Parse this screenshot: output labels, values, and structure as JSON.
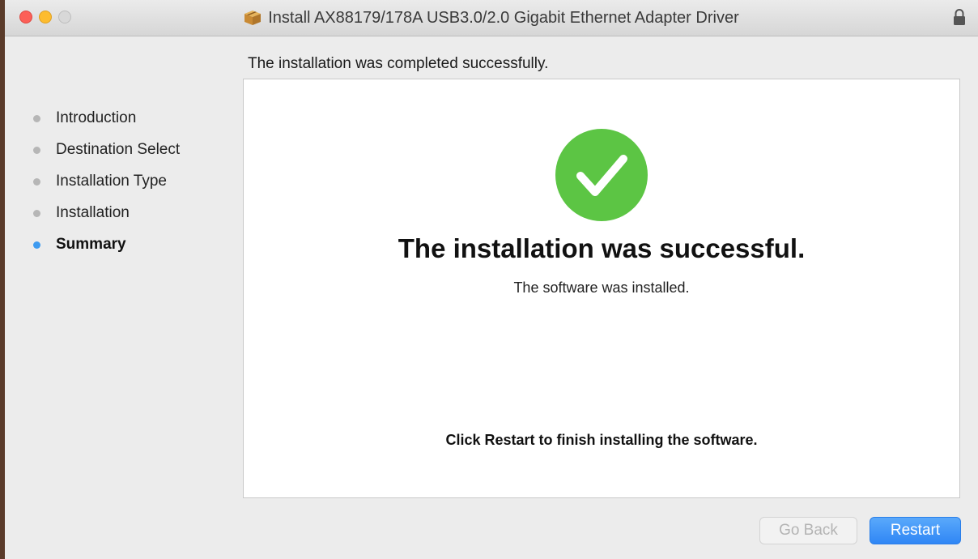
{
  "window": {
    "title": "Install AX88179/178A USB3.0/2.0 Gigabit Ethernet Adapter Driver"
  },
  "header": {
    "subtitle": "The installation was completed successfully."
  },
  "sidebar": {
    "steps": [
      {
        "label": "Introduction",
        "state": "complete"
      },
      {
        "label": "Destination Select",
        "state": "complete"
      },
      {
        "label": "Installation Type",
        "state": "complete"
      },
      {
        "label": "Installation",
        "state": "complete"
      },
      {
        "label": "Summary",
        "state": "current"
      }
    ]
  },
  "main": {
    "status_icon": "success-checkmark-icon",
    "headline": "The installation was successful.",
    "detail": "The software was installed.",
    "instruction": "Click Restart to finish installing the software."
  },
  "footer": {
    "back_label": "Go Back",
    "back_enabled": false,
    "primary_label": "Restart"
  },
  "colors": {
    "success_green": "#5cc544",
    "accent_blue": "#3e9bf0",
    "inactive_dot": "#b6b6b6"
  }
}
